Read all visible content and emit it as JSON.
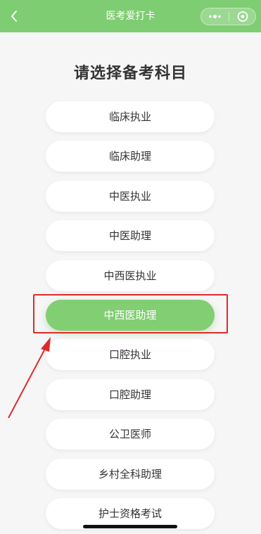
{
  "navbar": {
    "title": "医考爱打卡",
    "back_icon": "chevron-left-icon",
    "more_icon": "more-dots-icon",
    "close_icon": "target-circle-icon",
    "color": "#7fcd72"
  },
  "heading": "请选择备考科目",
  "options": [
    {
      "label": "临床执业"
    },
    {
      "label": "临床助理"
    },
    {
      "label": "中医执业"
    },
    {
      "label": "中医助理"
    },
    {
      "label": "中西医执业"
    },
    {
      "label": "中西医助理",
      "selected": true
    },
    {
      "label": "口腔执业"
    },
    {
      "label": "口腔助理"
    },
    {
      "label": "公卫医师"
    },
    {
      "label": "乡村全科助理"
    },
    {
      "label": "护士资格考试"
    }
  ],
  "colors": {
    "selected_bg": "#82ce73",
    "annotation_red": "#e02a2a"
  }
}
